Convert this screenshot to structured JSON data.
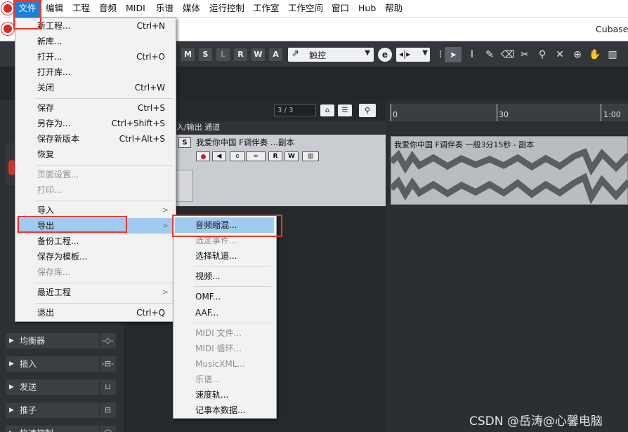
{
  "app": {
    "name": "Cubase"
  },
  "menubar": {
    "items": [
      "文件",
      "编辑",
      "工程",
      "音频",
      "MIDI",
      "乐谱",
      "媒体",
      "运行控制",
      "工作室",
      "工作空间",
      "窗口",
      "Hub",
      "帮助"
    ]
  },
  "toolbar": {
    "mode_buttons": [
      "M",
      "S",
      "L",
      "R",
      "W",
      "A"
    ],
    "automation_mode": "触控"
  },
  "project": {
    "track_counter": "3 / 3",
    "io_label": "入/输出 通道",
    "track_name": "我爱你中国 F调伴奏 ...副本",
    "track_buttons": {
      "solo": "S",
      "read": "R",
      "write": "W"
    }
  },
  "ruler": {
    "marks": [
      "0",
      "30",
      "1:00"
    ]
  },
  "clip": {
    "title": "我爱你中国 F调伴奏 一般3分15秒 - 副本"
  },
  "inspector": {
    "sections": [
      "均衡器",
      "插入",
      "发送",
      "推子",
      "快速控制"
    ]
  },
  "file_menu": {
    "items": [
      {
        "label": "新工程...",
        "shortcut": "Ctrl+N"
      },
      {
        "label": "新库...",
        "shortcut": ""
      },
      {
        "label": "打开...",
        "shortcut": "Ctrl+O"
      },
      {
        "label": "打开库...",
        "shortcut": ""
      },
      {
        "label": "关闭",
        "shortcut": "Ctrl+W"
      },
      {
        "label": "保存",
        "shortcut": "Ctrl+S"
      },
      {
        "label": "另存为...",
        "shortcut": "Ctrl+Shift+S"
      },
      {
        "label": "保存新版本",
        "shortcut": "Ctrl+Alt+S"
      },
      {
        "label": "恢复",
        "shortcut": ""
      },
      {
        "label": "页面设置...",
        "shortcut": ""
      },
      {
        "label": "打印...",
        "shortcut": ""
      },
      {
        "label": "导入",
        "shortcut": ""
      },
      {
        "label": "导出",
        "shortcut": ""
      },
      {
        "label": "备份工程...",
        "shortcut": ""
      },
      {
        "label": "保存为模板...",
        "shortcut": ""
      },
      {
        "label": "保存库...",
        "shortcut": ""
      },
      {
        "label": "最近工程",
        "shortcut": ""
      },
      {
        "label": "退出",
        "shortcut": "Ctrl+Q"
      }
    ]
  },
  "export_submenu": {
    "items": [
      "音频缩混...",
      "选定事件...",
      "选择轨道...",
      "视频...",
      "OMF...",
      "AAF...",
      "MIDI 文件...",
      "MIDI 循环...",
      "MusicXML...",
      "乐谱...",
      "速度轨...",
      "记事本数据..."
    ]
  },
  "watermark": "CSDN @岳涛@心馨电脑",
  "colors": {
    "menu_highlight": "#9fcbf0",
    "menubar_selected": "#1e7fd8",
    "annotation_red": "#e8382c"
  }
}
